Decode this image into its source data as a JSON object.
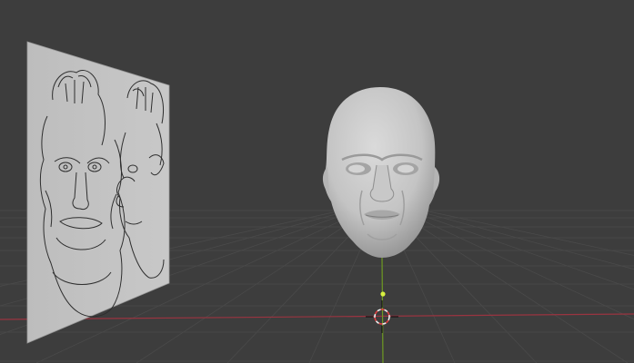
{
  "viewport": {
    "mode": "3d-viewport-solid-shading",
    "colors": {
      "background": "#3d3d3d",
      "grid_line": "#4a4a4a",
      "x_axis": "#9a3440",
      "y_axis": "#6e9a22",
      "head_mesh": "#c9c9c9",
      "reference_plane": "#c2c2c2",
      "sketch_lines": "#2e2e2e",
      "cursor_ring_red": "#e04040",
      "cursor_ring_white": "#f0f0f0",
      "origin_dot": "#d8f040"
    }
  },
  "objects": {
    "head": {
      "icon": "sculpted-head-mesh"
    },
    "reference_image": {
      "icon": "character-sketch-front-side"
    },
    "cursor_3d": {
      "icon": "3d-cursor"
    },
    "origin": {
      "icon": "object-origin-dot"
    }
  }
}
